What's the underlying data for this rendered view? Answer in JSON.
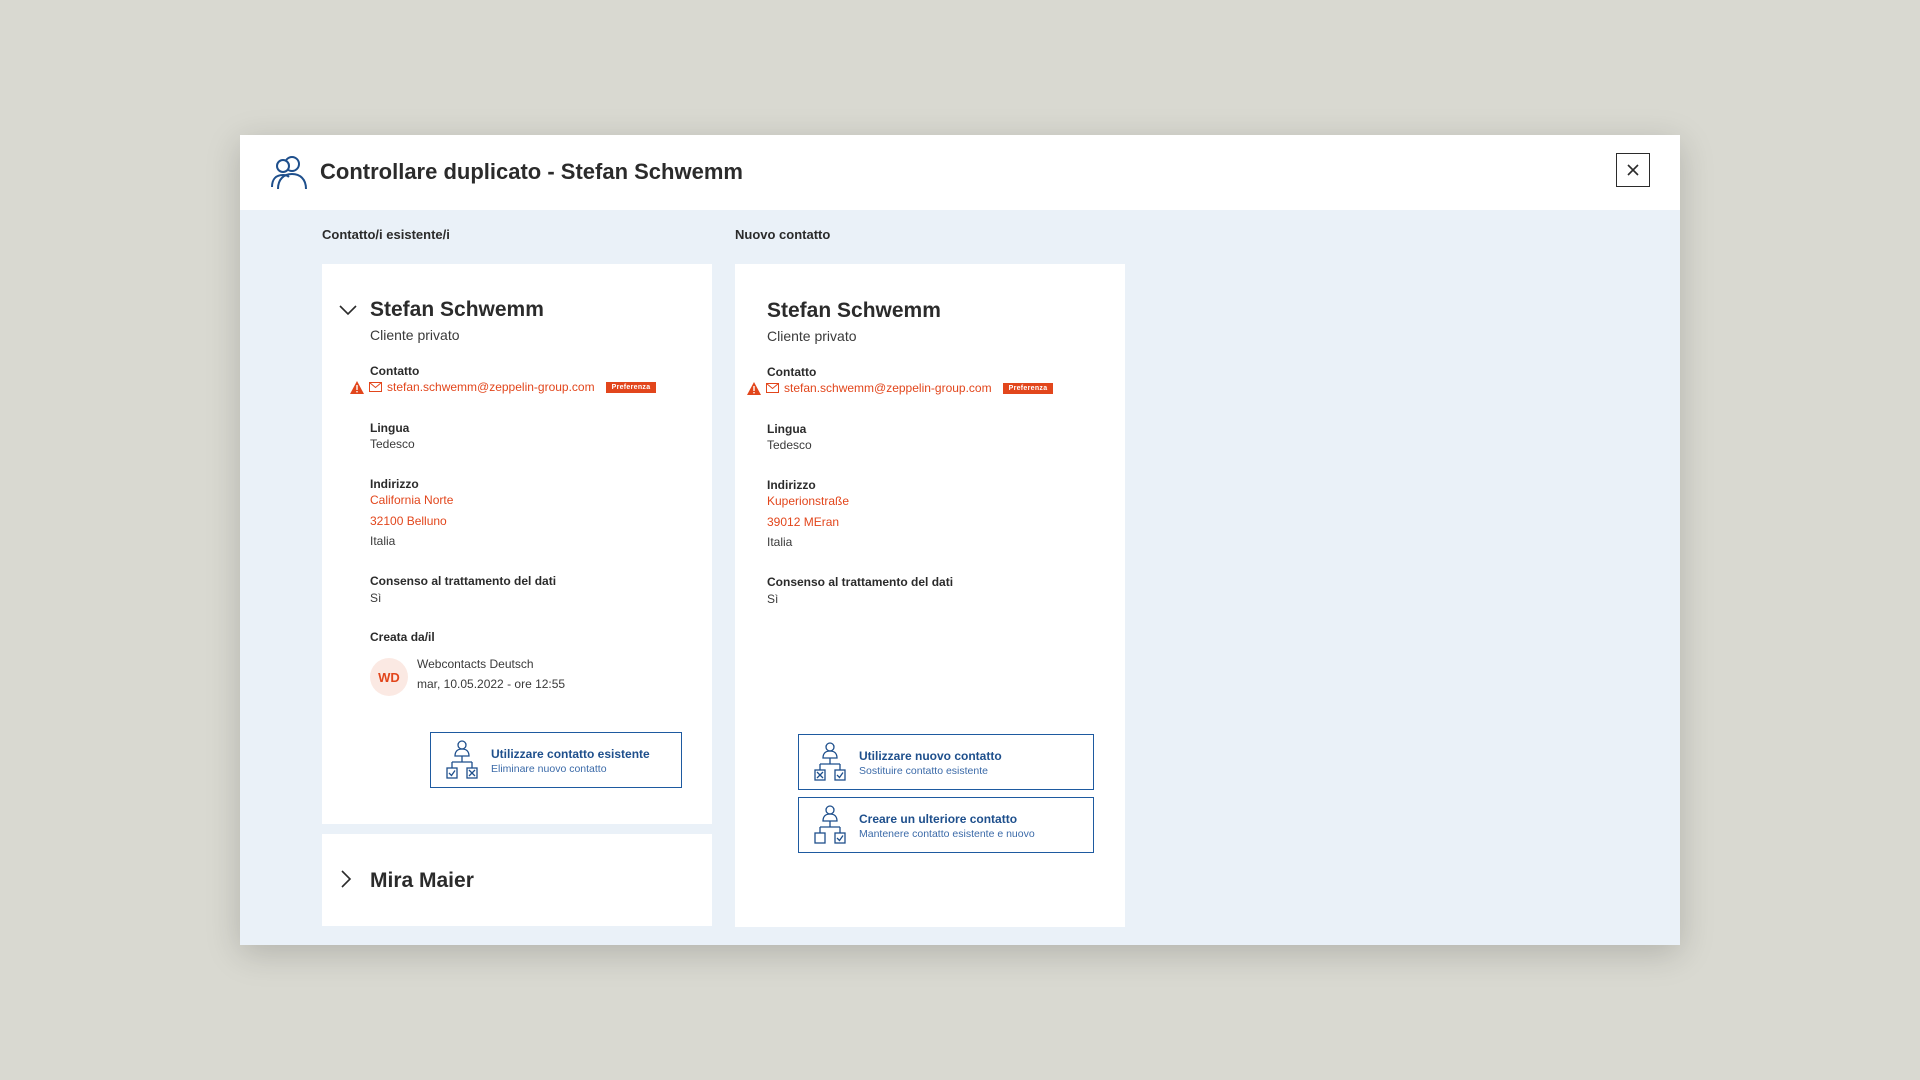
{
  "modal": {
    "title": "Controllare duplicato - Stefan Schwemm",
    "header_icon": "users-icon",
    "close_icon": "close-icon"
  },
  "columns": {
    "existing_label": "Contatto/i esistente/i",
    "new_label": "Nuovo contatto"
  },
  "existing_contact": {
    "name": "Stefan Schwemm",
    "type": "Cliente privato",
    "contact_label": "Contatto",
    "email": "stefan.schwemm@zeppelin-group.com",
    "pref_badge": "Preferenza",
    "language_label": "Lingua",
    "language": "Tedesco",
    "address_label": "Indirizzo",
    "address_line1": "California Norte",
    "address_line2": "32100 Belluno",
    "address_country": "Italia",
    "consent_label": "Consenso al trattamento del dati",
    "consent": "Sì",
    "created_label": "Creata da/il",
    "creator_initials": "WD",
    "creator_name": "Webcontacts Deutsch",
    "created_at": "mar, 10.05.2022 - ore 12:55",
    "action": {
      "title": "Utilizzare contatto esistente",
      "subtitle": "Eliminare nuovo contatto"
    }
  },
  "other_contact": {
    "name": "Mira Maier"
  },
  "new_contact": {
    "name": "Stefan Schwemm",
    "type": "Cliente privato",
    "contact_label": "Contatto",
    "email": "stefan.schwemm@zeppelin-group.com",
    "pref_badge": "Preferenza",
    "language_label": "Lingua",
    "language": "Tedesco",
    "address_label": "Indirizzo",
    "address_line1": "Kuperionstraße",
    "address_line2": "39012 MEran",
    "address_country": "Italia",
    "consent_label": "Consenso al trattamento del dati",
    "consent": "Sì",
    "action_use": {
      "title": "Utilizzare nuovo contatto",
      "subtitle": "Sostituire contatto esistente"
    },
    "action_create": {
      "title": "Creare un ulteriore contatto",
      "subtitle": "Mantenere contatto esistente e nuovo"
    }
  },
  "colors": {
    "accent": "#e2461c",
    "primary": "#1e5aa0",
    "panel_bg": "#eaf1f8",
    "page_bg": "#d9d9d1"
  }
}
